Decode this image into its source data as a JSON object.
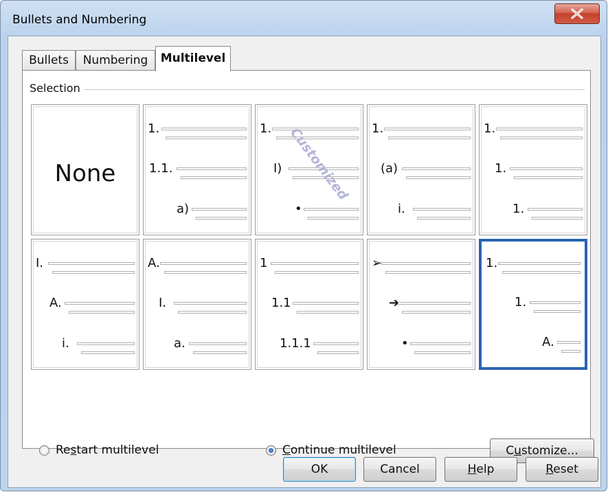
{
  "window": {
    "title": "Bullets and Numbering",
    "close_glyph": "✕"
  },
  "tabs": [
    {
      "label": "Bullets",
      "active": false
    },
    {
      "label": "Numbering",
      "active": false
    },
    {
      "label": "Multilevel",
      "active": true
    }
  ],
  "selection": {
    "label": "Selection",
    "none_label": "None",
    "watermark": "Customized",
    "tiles": [
      {
        "labels": []
      },
      {
        "labels": [
          "1.",
          "1.1.",
          "a)"
        ]
      },
      {
        "labels": [
          "1.",
          "I)",
          "•"
        ]
      },
      {
        "labels": [
          "1.",
          "(a)",
          "i."
        ]
      },
      {
        "labels": [
          "1.",
          "1.",
          "1."
        ]
      },
      {
        "labels": [
          "I.",
          "A.",
          "i."
        ]
      },
      {
        "labels": [
          "A.",
          "I.",
          "a."
        ]
      },
      {
        "labels": [
          "1",
          "1.1",
          "1.1.1"
        ]
      },
      {
        "labels": [
          "➢",
          "➔",
          "•"
        ]
      },
      {
        "labels": [
          "1.",
          "1.",
          "A."
        ],
        "selected": true
      }
    ]
  },
  "options": {
    "restart": {
      "label_pre": "Re",
      "label_u": "s",
      "label_post": "tart multilevel",
      "checked": false
    },
    "continue": {
      "label_pre": "",
      "label_u": "C",
      "label_post": "ontinue multilevel",
      "checked": true
    }
  },
  "buttons": {
    "customize": {
      "pre": "C",
      "u": "u",
      "post": "stomize..."
    },
    "ok": "OK",
    "cancel": "Cancel",
    "help": {
      "u": "H",
      "post": "elp"
    },
    "reset": {
      "u": "R",
      "post": "eset"
    }
  }
}
